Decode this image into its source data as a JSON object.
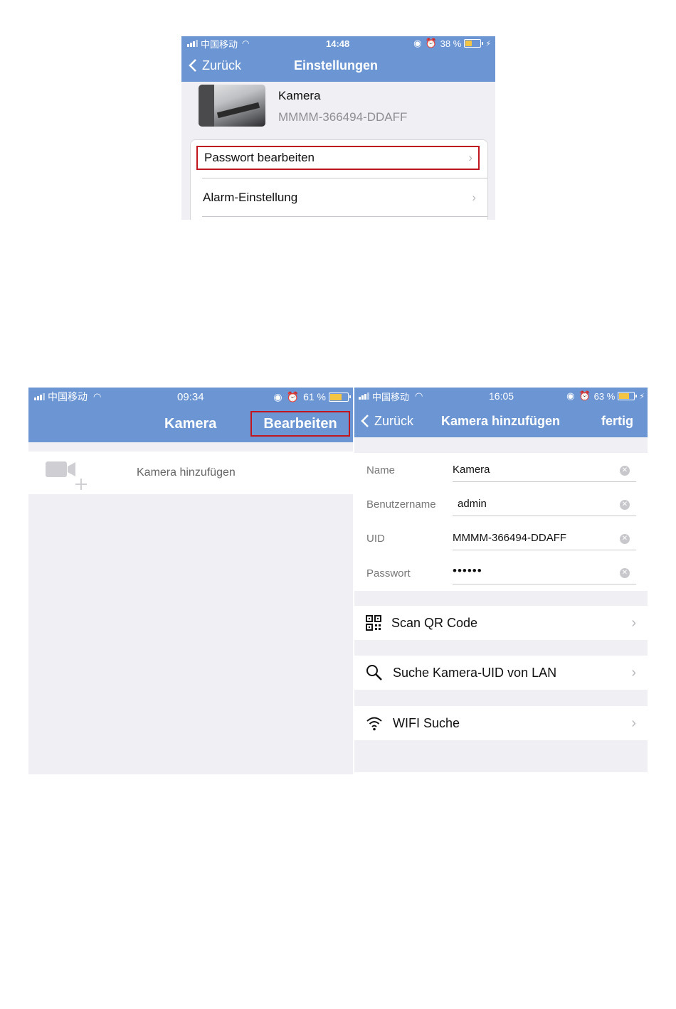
{
  "screen1": {
    "status": {
      "carrier": "中国移动",
      "time": "14:48",
      "battery": "38 %",
      "battery_level": 0.38
    },
    "nav": {
      "back_label": "Zurück",
      "title": "Einstellungen"
    },
    "camera": {
      "name": "Kamera",
      "uid": "MMMM-366494-DDAFF"
    },
    "items": [
      {
        "label": "Passwort bearbeiten",
        "highlighted": true
      },
      {
        "label": "Alarm-Einstellung",
        "highlighted": false
      }
    ]
  },
  "screen2": {
    "status": {
      "carrier": "中国移动",
      "time": "09:34",
      "battery": "61 %",
      "battery_level": 0.61
    },
    "nav": {
      "title": "Kamera",
      "edit_label": "Bearbeiten"
    },
    "add_camera_label": "Kamera hinzufügen"
  },
  "screen3": {
    "status": {
      "carrier": "中国移动",
      "time": "16:05",
      "battery": "63 %",
      "battery_level": 0.63
    },
    "nav": {
      "back_label": "Zurück",
      "title": "Kamera hinzufügen",
      "done_label": "fertig"
    },
    "fields": [
      {
        "label": "Name",
        "value": "Kamera"
      },
      {
        "label": "Benutzername",
        "value": "admin"
      },
      {
        "label": "UID",
        "value": "MMMM-366494-DDAFF"
      },
      {
        "label": "Passwort",
        "value": "••••••"
      }
    ],
    "actions": [
      {
        "label": "Scan QR Code",
        "icon": "qr-code-icon"
      },
      {
        "label": "Suche Kamera-UID von LAN",
        "icon": "search-icon"
      },
      {
        "label": "WIFI Suche",
        "icon": "wifi-icon"
      }
    ]
  },
  "colors": {
    "nav_blue": "#6b95d3",
    "highlight_red": "#c0161f",
    "list_bg": "#efeff4"
  }
}
